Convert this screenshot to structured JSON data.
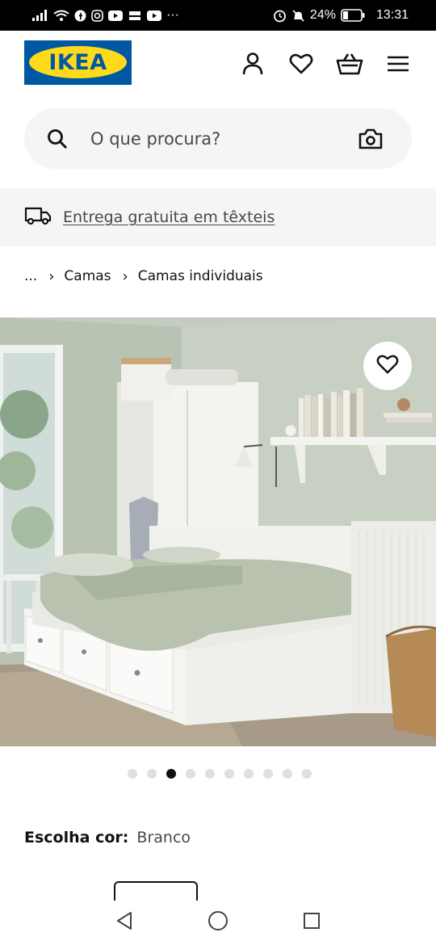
{
  "status_bar": {
    "battery": "24%",
    "time": "13:31",
    "extra": "···"
  },
  "header": {
    "logo_text": "IKEA",
    "icons": [
      "account-icon",
      "heart-icon",
      "basket-icon",
      "menu-icon"
    ]
  },
  "search": {
    "placeholder": "O que procura?"
  },
  "promo": {
    "text": "Entrega gratuita em têxteis"
  },
  "breadcrumb": {
    "ellipsis": "...",
    "items": [
      "Camas",
      "Camas individuais"
    ]
  },
  "gallery": {
    "image_count": 10,
    "active_index": 2
  },
  "color_choice": {
    "label": "Escolha cor:",
    "value": "Branco"
  },
  "colors": {
    "ikea_blue": "#0058a3",
    "ikea_yellow": "#ffda1a"
  }
}
